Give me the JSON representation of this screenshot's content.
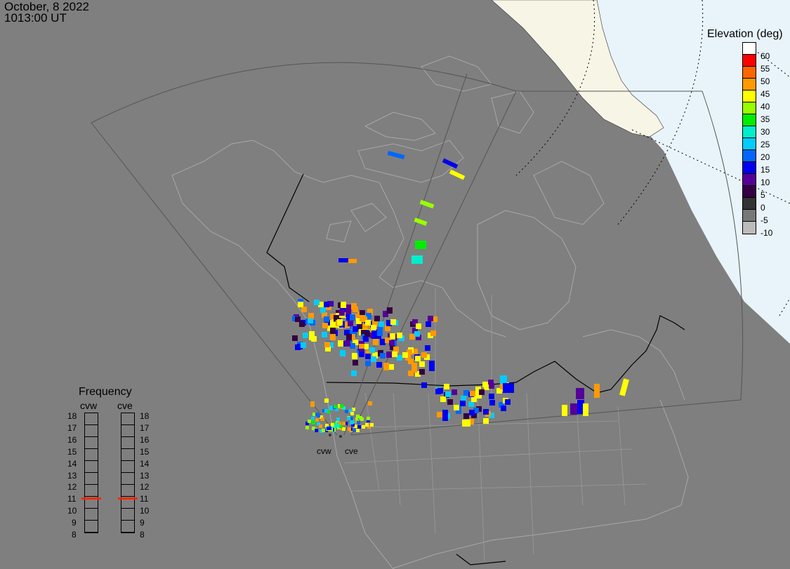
{
  "header": {
    "date": "October, 8 2022",
    "time": "1013:00 UT"
  },
  "elevation_legend": {
    "title": "Elevation (deg)",
    "levels": [
      {
        "label": "60",
        "color": "#ff0000"
      },
      {
        "label": "55",
        "color": "#ff6600"
      },
      {
        "label": "50",
        "color": "#ff9900"
      },
      {
        "label": "45",
        "color": "#ffff00"
      },
      {
        "label": "40",
        "color": "#99ff00"
      },
      {
        "label": "35",
        "color": "#00ee00"
      },
      {
        "label": "30",
        "color": "#00eecc"
      },
      {
        "label": "25",
        "color": "#00ccff"
      },
      {
        "label": "20",
        "color": "#0066ff"
      },
      {
        "label": "15",
        "color": "#0000ee"
      },
      {
        "label": "10",
        "color": "#550099"
      },
      {
        "label": "5",
        "color": "#330044"
      },
      {
        "label": "0",
        "color": "#333333"
      },
      {
        "label": "-5",
        "color": "#777777"
      },
      {
        "label": "-10",
        "color": "#bbbbbb"
      }
    ],
    "top_color": "#ffffff"
  },
  "frequency": {
    "title": "Frequency",
    "radars": [
      {
        "name": "cvw",
        "value": 10.9
      },
      {
        "name": "cve",
        "value": 10.9
      }
    ],
    "ticks": [
      "18",
      "17",
      "16",
      "15",
      "14",
      "13",
      "12",
      "11",
      "10",
      "9",
      "8"
    ]
  },
  "radar_sites": [
    {
      "name": "cvw"
    },
    {
      "name": "cve"
    }
  ],
  "colors": {
    "land": "#7f7f7f",
    "daylight": "#e8f4fa",
    "ice": "#f7f5e6",
    "coast": "#a8a8a8",
    "border": "#000000",
    "fov": "#555555",
    "marker": "#ff2a00"
  }
}
